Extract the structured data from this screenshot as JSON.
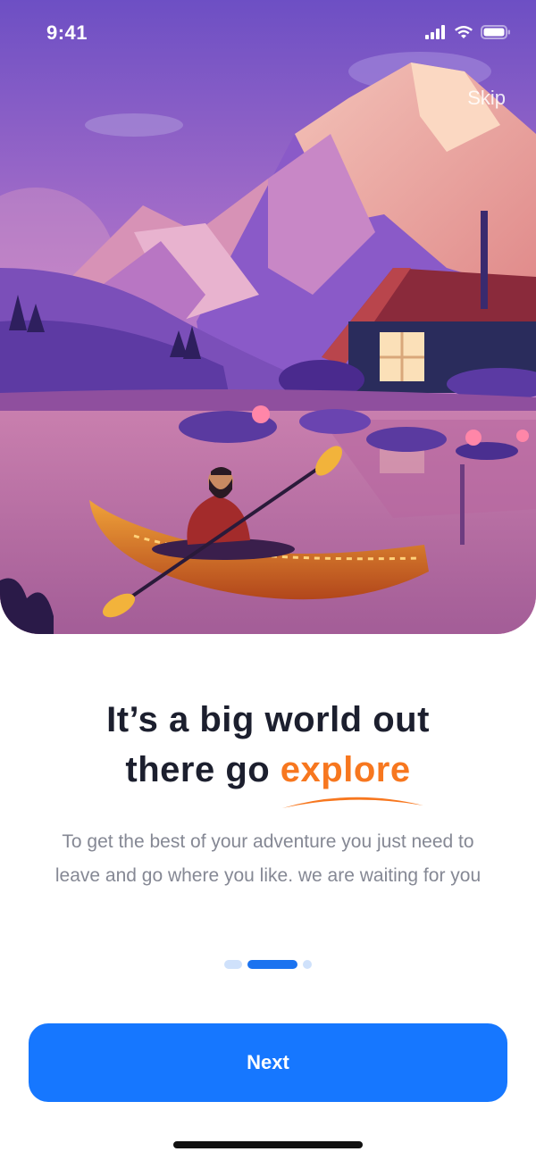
{
  "status_bar": {
    "time": "9:41",
    "icons": [
      "signal-icon",
      "wifi-icon",
      "battery-icon"
    ]
  },
  "hero": {
    "illustration": "mountain-lake-kayak-cabin-illustration",
    "skip_label": "Skip"
  },
  "onboarding": {
    "title_line1": "It’s a big world out",
    "title_line2_prefix": "there go ",
    "title_accent": "explore",
    "subtitle": "To get the best of your adventure you just need to leave and go where you like. we are waiting for you",
    "page_indicator": {
      "total": 3,
      "active_index": 1
    }
  },
  "actions": {
    "next_label": "Next"
  },
  "colors": {
    "accent": "#f7771f",
    "primary": "#1677ff",
    "title": "#1c1f2e",
    "body_text": "#858894",
    "indicator_inactive": "#cfe1fb"
  }
}
